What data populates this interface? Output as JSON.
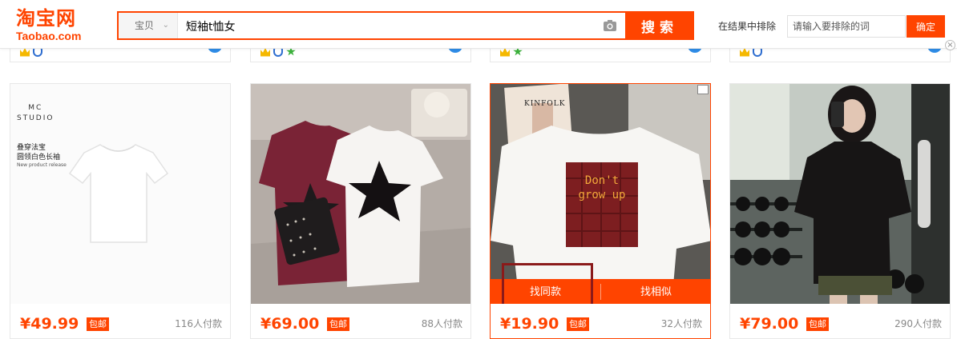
{
  "header": {
    "logo": {
      "cn": "淘宝网",
      "en": "Taobao.com"
    },
    "search": {
      "scope": "宝贝",
      "query": "短袖t恤女",
      "button": "搜索"
    },
    "exclude": {
      "label": "在结果中排除",
      "placeholder": "请输入要排除的词",
      "button": "确定"
    }
  },
  "products": [
    {
      "price": "¥49.99",
      "shipping": "包邮",
      "buyers": "116人付款"
    },
    {
      "price": "¥69.00",
      "shipping": "包邮",
      "buyers": "88人付款"
    },
    {
      "price": "¥19.90",
      "shipping": "包邮",
      "buyers": "32人付款",
      "find_same": "找同款",
      "find_similar": "找相似",
      "print_text": "Don't grow up",
      "magazine": "KINFOLK"
    },
    {
      "price": "¥79.00",
      "shipping": "包邮",
      "buyers": "290人付款"
    }
  ],
  "product1_print": {
    "brand": "MC\nSTUDIO",
    "title": "叠穿法宝\n圆领白色长袖",
    "subtitle": "New product release"
  },
  "accent_color": "#ff4400"
}
